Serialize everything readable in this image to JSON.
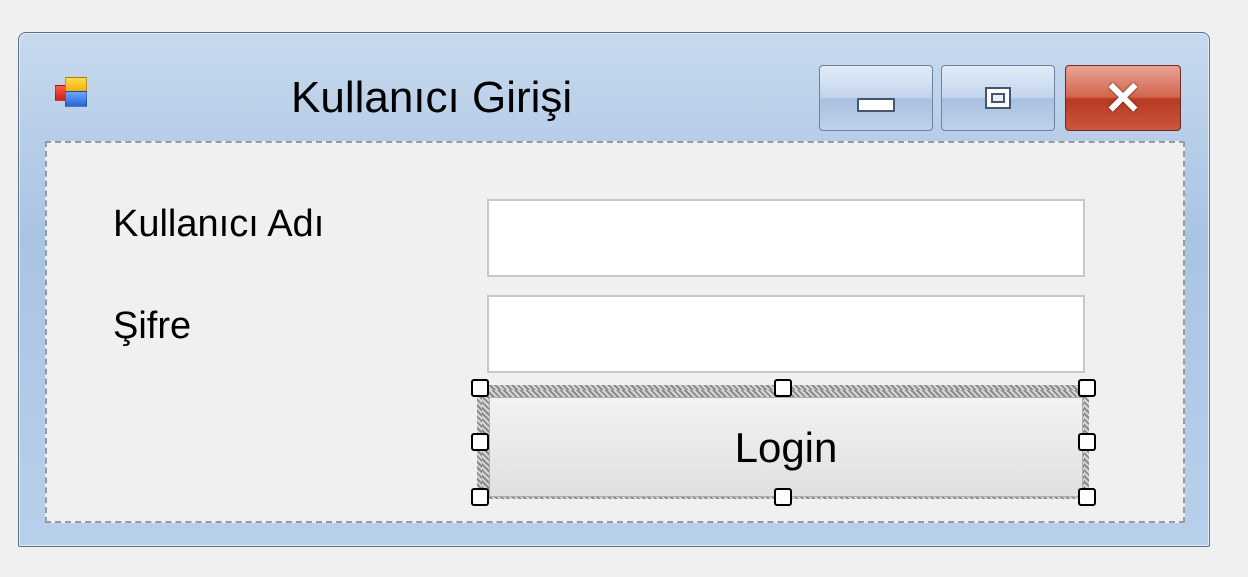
{
  "window": {
    "title": "Kullanıcı Girişi",
    "icon": "winforms-app-icon",
    "controls": {
      "minimize": "minimize-icon",
      "maximize": "maximize-icon",
      "close": "close-icon"
    }
  },
  "form": {
    "username_label": "Kullanıcı Adı",
    "username_value": "",
    "password_label": "Şifre",
    "password_value": "",
    "login_button_label": "Login",
    "selected_control": "login-button"
  },
  "colors": {
    "titlebar": "#b8d0ea",
    "close_button": "#c9563c",
    "client_background": "#f0f0f0"
  }
}
